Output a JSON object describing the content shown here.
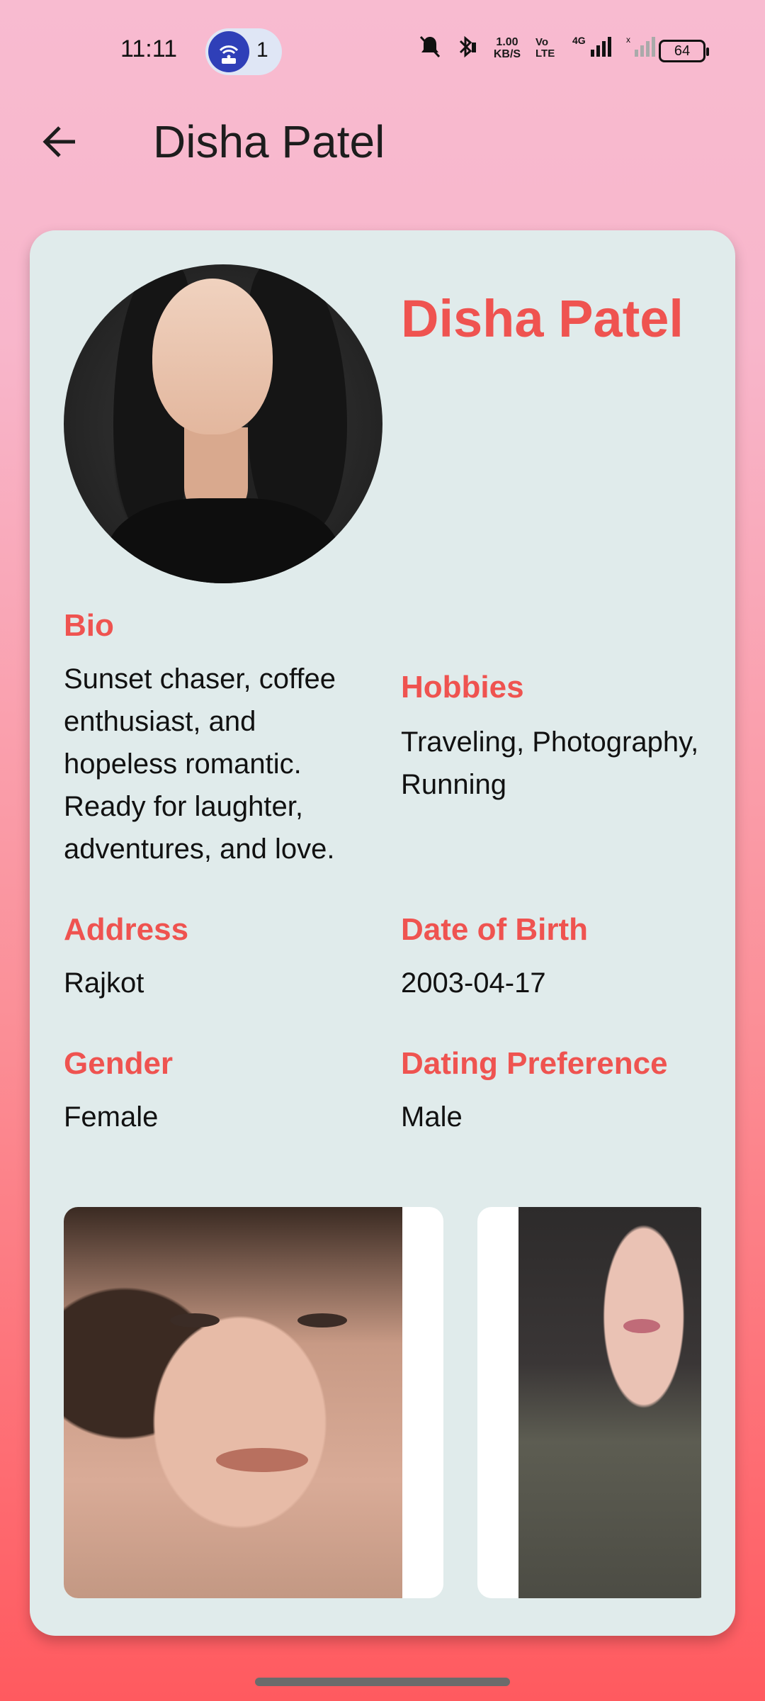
{
  "status_bar": {
    "time": "11:11",
    "notification_count": "1",
    "net_speed": "1.00 KB/S",
    "volte": "Vo LTE",
    "network": "4G",
    "battery": "64"
  },
  "app_bar": {
    "title": "Disha Patel",
    "back_icon": "arrow-back-icon"
  },
  "profile": {
    "name": "Disha Patel",
    "bio_label": "Bio",
    "bio": "Sunset chaser, coffee enthusiast, and hopeless romantic. Ready for laughter, adventures, and love.",
    "hobbies_label": "Hobbies",
    "hobbies": "Traveling, Photography, Running",
    "address_label": "Address",
    "address": "Rajkot",
    "dob_label": "Date of Birth",
    "dob": "2003-04-17",
    "gender_label": "Gender",
    "gender": "Female",
    "pref_label": "Dating Preference",
    "pref": "Male"
  },
  "colors": {
    "accent": "#ef5350",
    "card_bg": "#e0ebeb",
    "bg_top": "#f8bbd0",
    "bg_bottom": "#ff5a5f"
  }
}
